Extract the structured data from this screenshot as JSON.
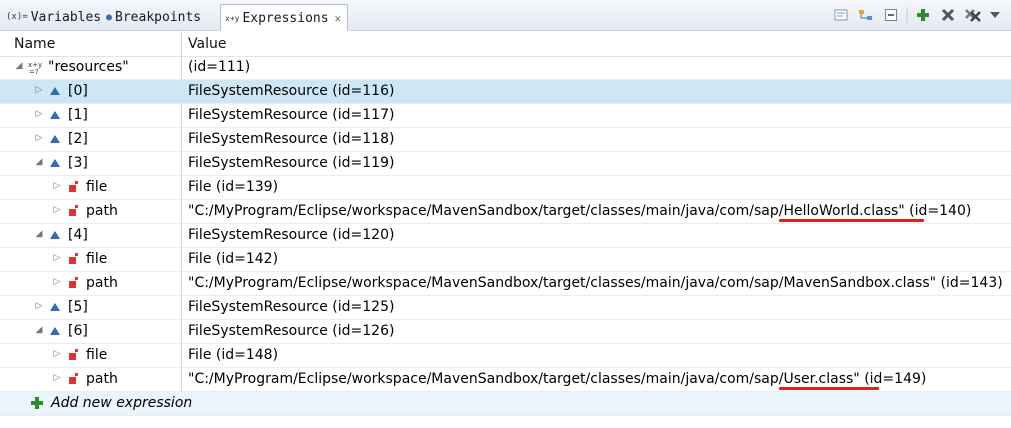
{
  "tabs": [
    {
      "label": "Variables",
      "glyph": "(x)="
    },
    {
      "label": "Breakpoints",
      "glyph": "●"
    },
    {
      "label": "Expressions",
      "glyph": "x+y"
    }
  ],
  "toolbar": {
    "buttons": [
      "show-type-names-icon",
      "show-logical-structure-icon",
      "collapse-all-icon",
      "add-expression-icon",
      "remove-icon",
      "remove-all-icon"
    ]
  },
  "columns": {
    "name": "Name",
    "value": "Value"
  },
  "rows": [
    {
      "name": "\"resources\"",
      "value": "(id=111)",
      "twisty": "expanded",
      "icon": "expression",
      "level": 0
    },
    {
      "name": "[0]",
      "value": "FileSystemResource  (id=116)",
      "twisty": "collapsed",
      "icon": "field-triangle",
      "level": 1,
      "selected": true
    },
    {
      "name": "[1]",
      "value": "FileSystemResource  (id=117)",
      "twisty": "collapsed",
      "icon": "field-triangle",
      "level": 1
    },
    {
      "name": "[2]",
      "value": "FileSystemResource  (id=118)",
      "twisty": "collapsed",
      "icon": "field-triangle",
      "level": 1
    },
    {
      "name": "[3]",
      "value": "FileSystemResource  (id=119)",
      "twisty": "expanded",
      "icon": "field-triangle",
      "level": 1
    },
    {
      "name": "file",
      "value": "File  (id=139)",
      "twisty": "collapsed",
      "icon": "private-field",
      "level": 2
    },
    {
      "name": "path",
      "value": "\"C:/MyProgram/Eclipse/workspace/MavenSandbox/target/classes/main/java/com/sap/HelloWorld.class\" (id=140)",
      "twisty": "collapsed",
      "icon": "private-field",
      "level": 2,
      "underline": true
    },
    {
      "name": "[4]",
      "value": "FileSystemResource  (id=120)",
      "twisty": "expanded",
      "icon": "field-triangle",
      "level": 1
    },
    {
      "name": "file",
      "value": "File  (id=142)",
      "twisty": "collapsed",
      "icon": "private-field",
      "level": 2
    },
    {
      "name": "path",
      "value": "\"C:/MyProgram/Eclipse/workspace/MavenSandbox/target/classes/main/java/com/sap/MavenSandbox.class\" (id=143)",
      "twisty": "collapsed",
      "icon": "private-field",
      "level": 2
    },
    {
      "name": "[5]",
      "value": "FileSystemResource  (id=125)",
      "twisty": "collapsed",
      "icon": "field-triangle",
      "level": 1
    },
    {
      "name": "[6]",
      "value": "FileSystemResource  (id=126)",
      "twisty": "expanded",
      "icon": "field-triangle",
      "level": 1
    },
    {
      "name": "file",
      "value": "File  (id=148)",
      "twisty": "collapsed",
      "icon": "private-field",
      "level": 2
    },
    {
      "name": "path",
      "value": "\"C:/MyProgram/Eclipse/workspace/MavenSandbox/target/classes/main/java/com/sap/User.class\" (id=149)",
      "twisty": "collapsed",
      "icon": "private-field",
      "level": 2,
      "underline": true
    }
  ],
  "new_expression": {
    "label": "Add new expression",
    "icon": "add-expression-icon"
  },
  "colors": {
    "selection": "#cde8f4",
    "annotation": "#e02020",
    "accent": "#2e8b2e"
  }
}
